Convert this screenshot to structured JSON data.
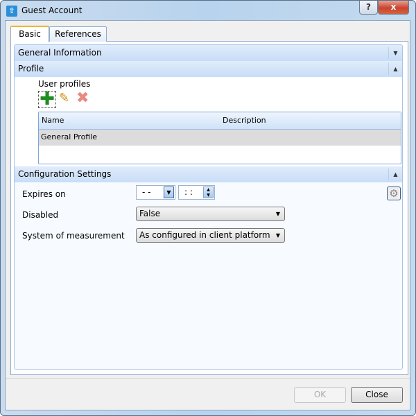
{
  "window": {
    "title": "Guest Account",
    "help_label": "?",
    "close_label": "x"
  },
  "tabs": [
    {
      "label": "Basic",
      "active": true
    },
    {
      "label": "References",
      "active": false
    }
  ],
  "sections": {
    "general": {
      "title": "General Information",
      "state": "collapsed"
    },
    "profile": {
      "title": "Profile",
      "state": "expanded",
      "user_profiles_label": "User profiles",
      "toolbar": [
        "add-icon",
        "edit-icon",
        "delete-icon"
      ],
      "columns": [
        "Name",
        "Description"
      ],
      "rows": [
        {
          "name": "General Profile",
          "description": ""
        }
      ]
    },
    "config": {
      "title": "Configuration Settings",
      "state": "expanded",
      "expires_label": "Expires on",
      "date_value": "- -",
      "time_value": ": :",
      "disabled_label": "Disabled",
      "disabled_value": "False",
      "measurement_label": "System of measurement",
      "measurement_value": "As configured in client platform"
    }
  },
  "footer": {
    "ok_label": "OK",
    "ok_enabled": false,
    "close_label": "Close"
  },
  "colors": {
    "section_header": "#c8ddf7",
    "accent_tab": "#f0b43a",
    "add": "#1f8c1f",
    "delete": "#e88a80"
  }
}
